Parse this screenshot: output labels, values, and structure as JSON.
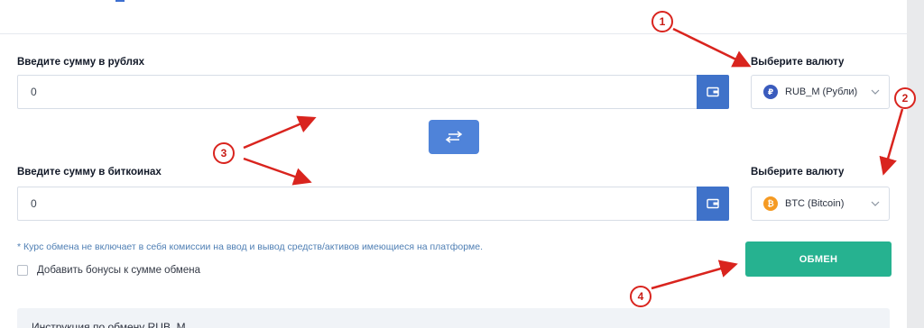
{
  "from": {
    "label": "Введите сумму в рублях",
    "value": "0",
    "currency_label": "Выберите валюту",
    "currency": "RUB_M (Рубли)",
    "coin_glyph": "₽"
  },
  "to": {
    "label": "Введите сумму в биткоинах",
    "value": "0",
    "currency_label": "Выберите валюту",
    "currency": "BTC (Bitcoin)",
    "coin_glyph": "₿"
  },
  "note": "* Курс обмена не включает в себя комиссии на ввод и вывод средств/активов имеющиеся на платформе.",
  "bonus_label": "Добавить бонусы к сумме обмена",
  "exchange_button": "ОБМЕН",
  "bottom_text": "Инструкция по обмену RUB_M",
  "annotations": [
    "1",
    "2",
    "3",
    "4"
  ],
  "colors": {
    "primary": "#3f72c9",
    "accent_green": "#26b290",
    "annotation_red": "#d9241e",
    "rub_coin": "#3a5bbd",
    "btc_coin": "#f59a23"
  },
  "icons": [
    "wallet-icon",
    "swap-arrows-icon",
    "chevron-down-icon",
    "ruble-coin-icon",
    "bitcoin-coin-icon"
  ]
}
